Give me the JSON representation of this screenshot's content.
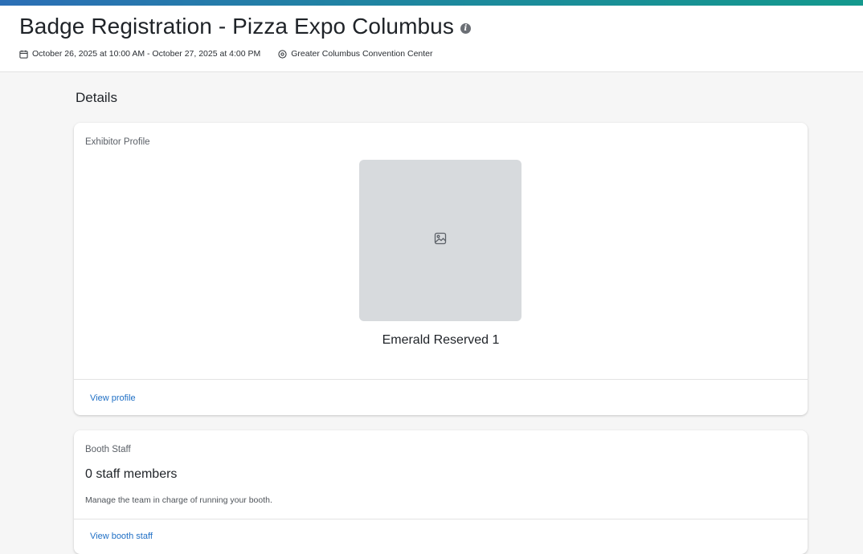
{
  "header": {
    "title": "Badge Registration - Pizza Expo Columbus",
    "info_icon": "info-icon",
    "date_range": "October 26, 2025 at 10:00 AM - October 27, 2025 at 4:00 PM",
    "date_icon": "calendar-icon",
    "location": "Greater Columbus Convention Center",
    "location_icon": "location-pin-icon",
    "accent_colors": [
      "#2c6fb6",
      "#14998d"
    ]
  },
  "details": {
    "heading": "Details",
    "exhibitor_profile": {
      "label": "Exhibitor Profile",
      "image_icon": "image-placeholder-icon",
      "name": "Emerald Reserved 1",
      "link_label": "View profile"
    },
    "booth_staff": {
      "label": "Booth Staff",
      "count_text": "0 staff members",
      "description": "Manage the team in charge of running your booth.",
      "link_label": "View booth staff"
    },
    "link_color": "#1f6fc5"
  }
}
